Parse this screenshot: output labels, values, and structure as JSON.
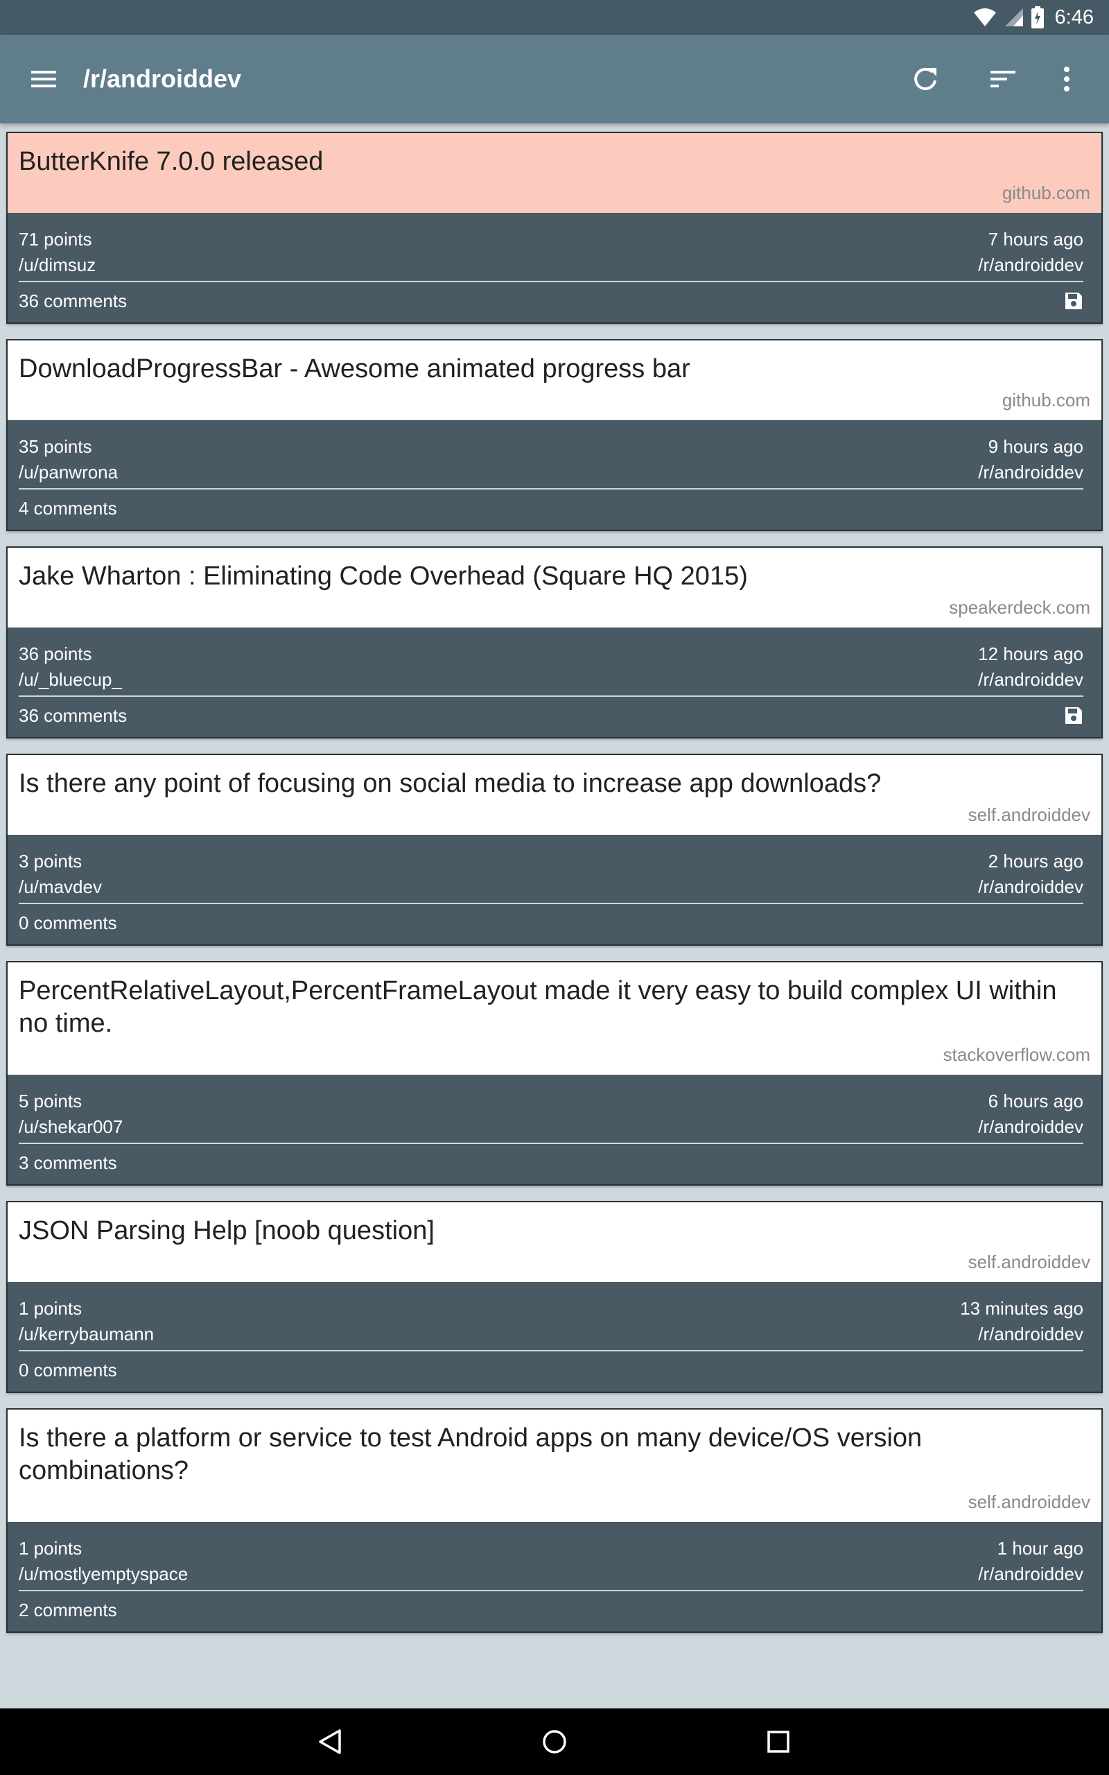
{
  "status": {
    "time": "6:46"
  },
  "toolbar": {
    "title": "/r/androiddev",
    "menu_icon": "hamburger-menu-icon",
    "refresh_icon": "refresh-icon",
    "sort_icon": "sort-icon",
    "overflow_icon": "more-vert-icon"
  },
  "colors": {
    "app_bar": "#607d8b",
    "status_bar": "#455a64",
    "card_meta_bg": "#4a5a65",
    "highlight": "#fccbbd",
    "page_bg": "#cfd8dc"
  },
  "posts": [
    {
      "title": "ButterKnife 7.0.0 released",
      "domain": "github.com",
      "points": "71 points",
      "time": "7 hours ago",
      "author": "/u/dimsuz",
      "subreddit": "/r/androiddev",
      "comments": "36 comments",
      "saved": true,
      "highlighted": true
    },
    {
      "title": "DownloadProgressBar - Awesome animated progress bar",
      "domain": "github.com",
      "points": "35 points",
      "time": "9 hours ago",
      "author": "/u/panwrona",
      "subreddit": "/r/androiddev",
      "comments": "4 comments",
      "saved": false,
      "highlighted": false
    },
    {
      "title": "Jake Wharton : Eliminating Code Overhead (Square HQ 2015)",
      "domain": "speakerdeck.com",
      "points": "36 points",
      "time": "12 hours ago",
      "author": "/u/_bluecup_",
      "subreddit": "/r/androiddev",
      "comments": "36 comments",
      "saved": true,
      "highlighted": false
    },
    {
      "title": "Is there any point of focusing on social media to increase app downloads?",
      "domain": "self.androiddev",
      "points": "3 points",
      "time": "2 hours ago",
      "author": "/u/mavdev",
      "subreddit": "/r/androiddev",
      "comments": "0 comments",
      "saved": false,
      "highlighted": false
    },
    {
      "title": "PercentRelativeLayout,PercentFrameLayout made it very easy to build complex UI within no time.",
      "domain": "stackoverflow.com",
      "points": "5 points",
      "time": "6 hours ago",
      "author": "/u/shekar007",
      "subreddit": "/r/androiddev",
      "comments": "3 comments",
      "saved": false,
      "highlighted": false
    },
    {
      "title": "JSON Parsing Help [noob question]",
      "domain": "self.androiddev",
      "points": "1 points",
      "time": "13 minutes ago",
      "author": "/u/kerrybaumann",
      "subreddit": "/r/androiddev",
      "comments": "0 comments",
      "saved": false,
      "highlighted": false
    },
    {
      "title": "Is there a platform or service to test Android apps on many device/OS version combinations?",
      "domain": "self.androiddev",
      "points": "1 points",
      "time": "1 hour ago",
      "author": "/u/mostlyemptyspace",
      "subreddit": "/r/androiddev",
      "comments": "2 comments",
      "saved": false,
      "highlighted": false
    }
  ],
  "navbar": {
    "back_icon": "back-icon",
    "home_icon": "home-icon",
    "recents_icon": "recents-icon"
  }
}
